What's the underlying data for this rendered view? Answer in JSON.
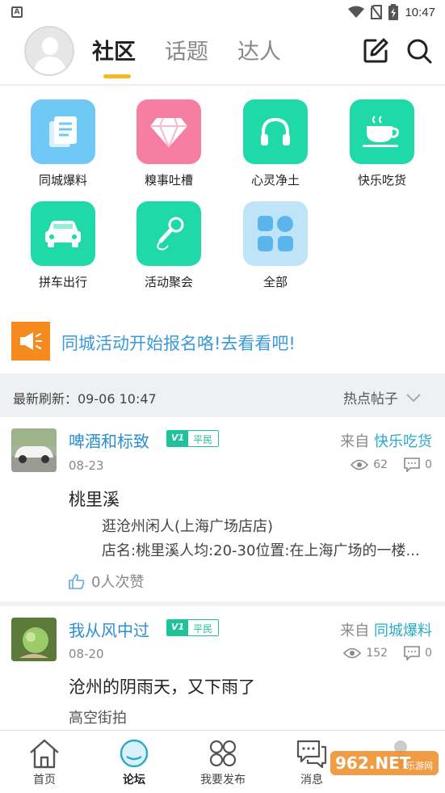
{
  "status_bar": {
    "time": "10:47"
  },
  "header": {
    "tabs": [
      {
        "label": "社区",
        "active": true
      },
      {
        "label": "话题",
        "active": false
      },
      {
        "label": "达人",
        "active": false
      }
    ],
    "icons": [
      "avatar",
      "edit-icon",
      "search-icon"
    ]
  },
  "categories": [
    {
      "label": "同城爆料",
      "icon": "news-icon",
      "color": "#6fc8f5"
    },
    {
      "label": "糗事吐槽",
      "icon": "diamond-icon",
      "color": "#f57ea2"
    },
    {
      "label": "心灵净土",
      "icon": "headphones-icon",
      "color": "#1fd9a8"
    },
    {
      "label": "快乐吃货",
      "icon": "coffee-cup-icon",
      "color": "#1fd9a8"
    },
    {
      "label": "拼车出行",
      "icon": "car-icon",
      "color": "#1fd9a8"
    },
    {
      "label": "活动聚会",
      "icon": "microphone-icon",
      "color": "#1fd9a8"
    },
    {
      "label": "全部",
      "icon": "grid-icon",
      "color": "#bfe4f7"
    }
  ],
  "banner": {
    "text": "同城活动开始报名咯!去看看吧!",
    "icon": "megaphone-icon",
    "accent": "#f58a1f"
  },
  "refresh": {
    "label": "最新刷新：09-06 10:47",
    "sort": "热点帖子"
  },
  "posts": [
    {
      "user": "啤酒和标致",
      "level": "V1",
      "rank": "平民",
      "from_prefix": "来自",
      "from_board": "快乐吃货",
      "date": "08-23",
      "views": "62",
      "comments": "0",
      "title": "桃里溪",
      "lines": [
        "逛沧州闲人(上海广场店店)",
        "店名:桃里溪人均:20-30位置:在上海广场的一楼..."
      ],
      "likes": "0人次赞"
    },
    {
      "user": "我从风中过",
      "level": "V1",
      "rank": "平民",
      "from_prefix": "来自",
      "from_board": "同城爆料",
      "date": "08-20",
      "views": "152",
      "comments": "0",
      "title": "沧州的阴雨天，又下雨了",
      "sub": "高空街拍"
    }
  ],
  "bottom_nav": [
    {
      "label": "首页",
      "icon": "home-icon",
      "active": false
    },
    {
      "label": "论坛",
      "icon": "forum-icon",
      "active": true
    },
    {
      "label": "我要发布",
      "icon": "publish-grid-icon",
      "active": false
    },
    {
      "label": "消息",
      "icon": "message-icon",
      "active": false
    },
    {
      "label": "",
      "icon": "profile-icon",
      "active": false
    }
  ],
  "watermark": "962.NET 乐游网"
}
